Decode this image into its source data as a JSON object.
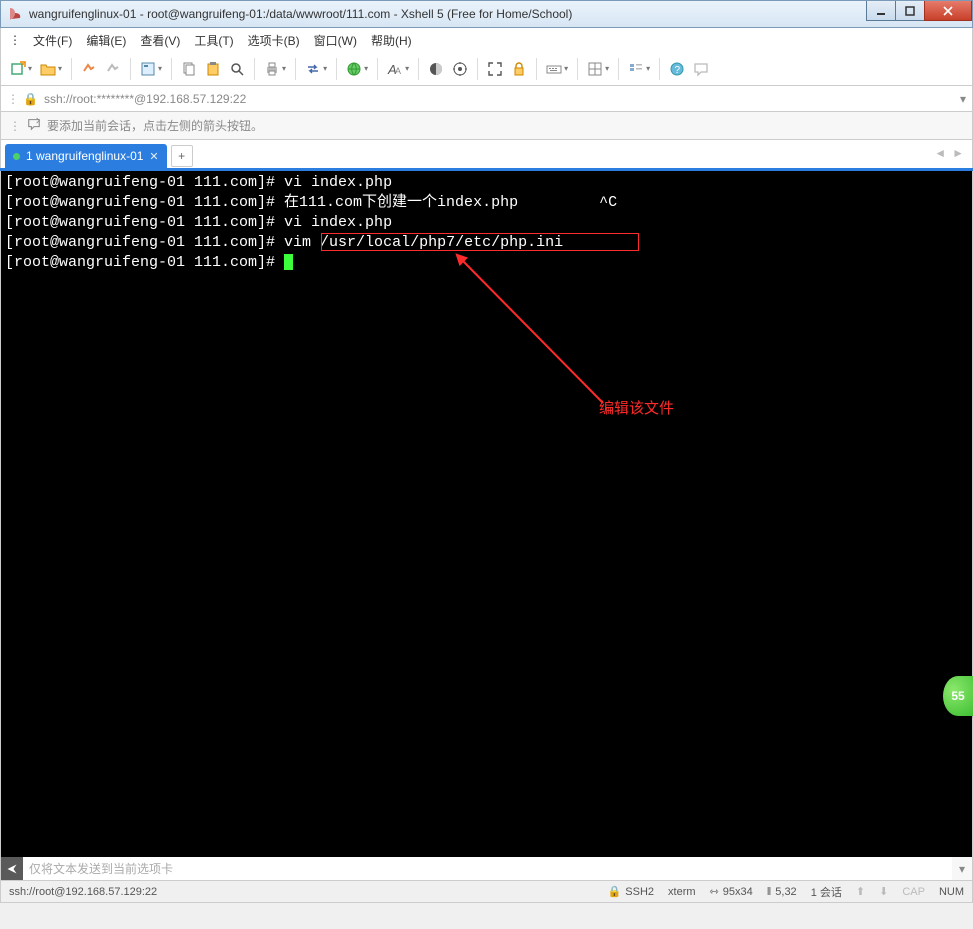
{
  "window": {
    "title": "wangruifenglinux-01 - root@wangruifeng-01:/data/wwwroot/111.com - Xshell 5 (Free for Home/School)"
  },
  "menu": {
    "file": "文件(F)",
    "edit": "编辑(E)",
    "view": "查看(V)",
    "tools": "工具(T)",
    "tabs": "选项卡(B)",
    "window": "窗口(W)",
    "help": "帮助(H)"
  },
  "address": {
    "value": "ssh://root:********@192.168.57.129:22"
  },
  "info": {
    "tip": "要添加当前会话，点击左侧的箭头按钮。"
  },
  "tab": {
    "label": "1 wangruifenglinux-01"
  },
  "terminal": {
    "prompt": "[root@wangruifeng-01 111.com]# ",
    "lines": [
      {
        "cmd": "vi index.php"
      },
      {
        "cmd": "在111.com下创建一个index.php",
        "tail": "         ^C"
      },
      {
        "cmd": "vi index.php"
      },
      {
        "cmd": "vim /usr/local/php7/etc/php.ini"
      },
      {
        "cmd": "",
        "cursor": true
      }
    ],
    "annotation": "编辑该文件"
  },
  "sendbar": {
    "placeholder": "仅将文本发送到当前选项卡"
  },
  "status": {
    "conn": "ssh://root@192.168.57.129:22",
    "proto": "SSH2",
    "term": "xterm",
    "size": "95x34",
    "pos": "5,32",
    "sessions": "1 会话",
    "cap": "CAP",
    "num": "NUM"
  },
  "badge": {
    "value": "55"
  },
  "icons": {
    "lock": "🔒",
    "plus": "+",
    "size_glyph": "⇿"
  }
}
